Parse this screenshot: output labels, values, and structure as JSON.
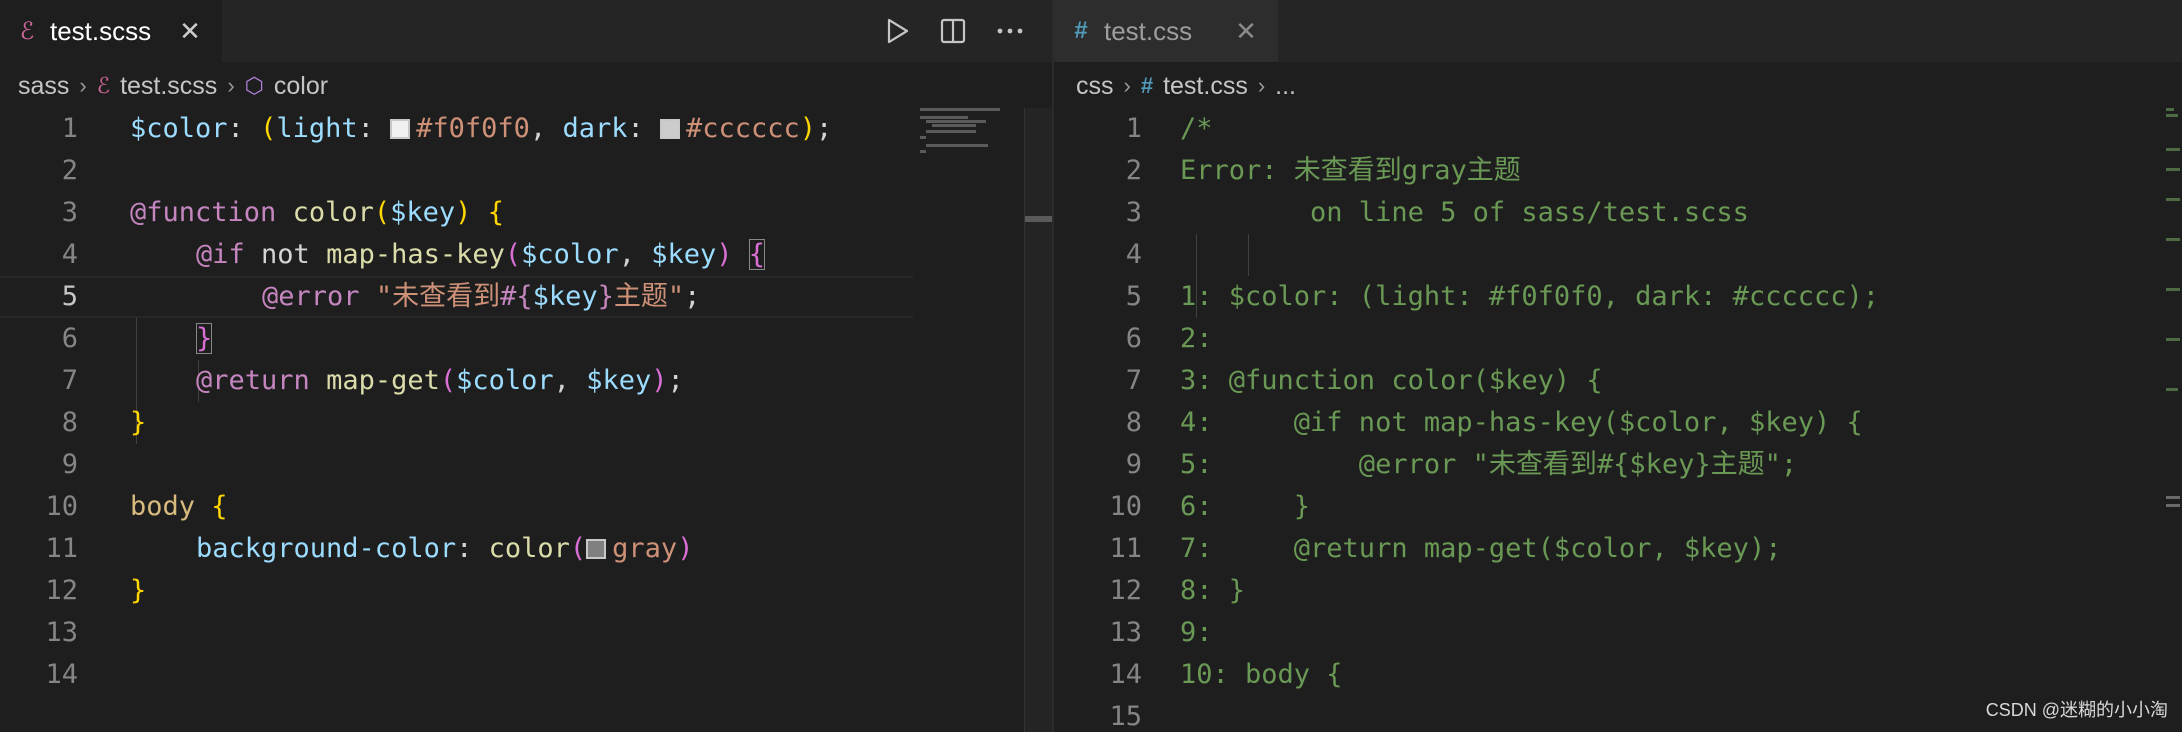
{
  "left_editor": {
    "tab": {
      "label": "test.scss",
      "icon": "sass-file-icon",
      "close": "✕"
    },
    "breadcrumb": {
      "folder": "sass",
      "file": "test.scss",
      "symbol": "color"
    },
    "current_line": 5,
    "line_numbers": [
      "1",
      "2",
      "3",
      "4",
      "5",
      "6",
      "7",
      "8",
      "9",
      "10",
      "11",
      "12",
      "13",
      "14"
    ],
    "code": {
      "l1": {
        "var": "$color",
        "colon": ": ",
        "open": "(",
        "k1": "light",
        "c1": ": ",
        "v1": "#f0f0f0",
        "comma": ", ",
        "k2": "dark",
        "c2": ": ",
        "v2": "#cccccc",
        "close": ")",
        "semi": ";"
      },
      "l3": {
        "kw": "@function",
        "sp": " ",
        "fn": "color",
        "open": "(",
        "arg": "$key",
        "close": ")",
        "sp2": " ",
        "brace": "{"
      },
      "l4": {
        "kw": "@if",
        "not": " not ",
        "fn": "map-has-key",
        "open": "(",
        "a1": "$color",
        "comma": ", ",
        "a2": "$key",
        "close": ")",
        "sp": " ",
        "brace": "{"
      },
      "l5": {
        "kw": "@error",
        "sp": " ",
        "s1": "\"未查看到",
        "interp": "#{",
        "var": "$key",
        "interp_close": "}",
        "s2": "主题\"",
        "semi": ";"
      },
      "l6": {
        "brace": "}"
      },
      "l7": {
        "kw": "@return",
        "sp": " ",
        "fn": "map-get",
        "open": "(",
        "a1": "$color",
        "comma": ", ",
        "a2": "$key",
        "close": ")",
        "semi": ";"
      },
      "l8": {
        "brace": "}"
      },
      "l10": {
        "tag": "body",
        "sp": " ",
        "brace": "{"
      },
      "l11": {
        "prop": "background-color",
        "colon": ": ",
        "fn": "color",
        "open": "(",
        "arg": "gray",
        "close": ")"
      },
      "l12": {
        "brace": "}"
      }
    },
    "swatches": {
      "light": "#f0f0f0",
      "dark": "#cccccc",
      "gray": "#808080"
    }
  },
  "right_editor": {
    "tab": {
      "label": "test.css",
      "icon": "css-file-icon",
      "close": "✕"
    },
    "breadcrumb": {
      "folder": "css",
      "file": "test.css",
      "symbol": "..."
    },
    "line_numbers": [
      "1",
      "2",
      "3",
      "4",
      "5",
      "6",
      "7",
      "8",
      "9",
      "10",
      "11",
      "12",
      "13",
      "14",
      "15"
    ],
    "lines": [
      "/*",
      "Error: 未查看到gray主题",
      "        on line 5 of sass/test.scss",
      "",
      "1: $color: (light: #f0f0f0, dark: #cccccc);",
      "2:",
      "3: @function color($key) {",
      "4:     @if not map-has-key($color, $key) {",
      "5:         @error \"未查看到#{$key}主题\";",
      "6:     }",
      "7:     @return map-get($color, $key);",
      "8: }",
      "9:",
      "10: body {",
      ""
    ]
  },
  "toolbar": {
    "run_icon": "play-icon",
    "split_icon": "split-editor-icon",
    "more_icon": "more-icon"
  },
  "watermark": "CSDN @迷糊的小小淘",
  "colors": {
    "editor_bg": "#1e1e1e",
    "tabbar_bg": "#252526",
    "comment": "#6a9955",
    "sass_icon": "#cd6799",
    "css_icon": "#519aba"
  }
}
